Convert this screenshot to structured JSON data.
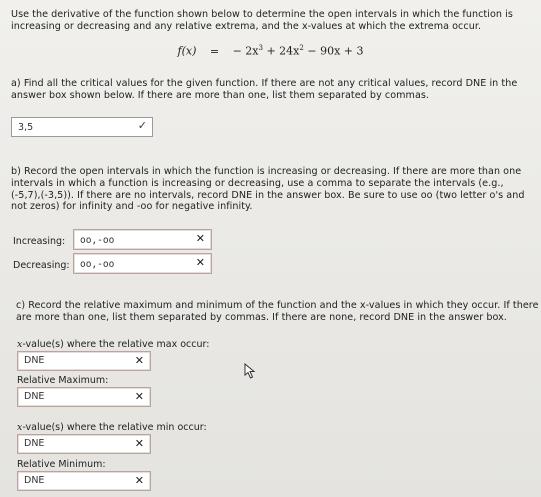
{
  "question": {
    "line1": "Use the derivative of the function shown below to determine the open intervals in which the function is",
    "line2": "increasing or decreasing and any relative extrema, and the x-values at which the extrema occur."
  },
  "equation": {
    "lhs": "f(x)",
    "eq": "=",
    "term1": "− 2x",
    "exp1": "3",
    "term2": " + 24x",
    "exp2": "2",
    "term3": " − 90x + 3"
  },
  "part_a": {
    "line1": "a) Find all the critical values for the given function. If there are not any critical values, record DNE in the",
    "line2": "answer box shown below. If there are more than one, list them separated by commas.",
    "answer": "3,5",
    "status": "correct"
  },
  "part_b": {
    "line1": "b) Record the open intervals in which the function is increasing or decreasing. If there are more than one",
    "line2": "intervals in which a function is increasing or decreasing, use a comma to separate the intervals (e.g.,",
    "line3": "(-5,7),(-3,5)). If there are no intervals, record DNE in the answer box. Be sure to use oo (two letter o's and",
    "line4": "not zeros) for infinity and -oo for negative infinity.",
    "increasing_label": "Increasing:",
    "increasing_value": "oo,-oo",
    "decreasing_label": "Decreasing:",
    "decreasing_value": "oo,-oo"
  },
  "part_c": {
    "line1": "c) Record the relative maximum and minimum of the function and the x-values in which they occur. If there",
    "line2": "are more than one, list them separated by commas. If there are none, record DNE in the answer box.",
    "max_x_label_var": "x",
    "max_x_label": "-value(s) where the relative max occur:",
    "max_x_value": "DNE",
    "rel_max_label": "Relative Maximum:",
    "rel_max_value": "DNE",
    "min_x_label_var": "x",
    "min_x_label": "-value(s) where the relative min occur:",
    "min_x_value": "DNE",
    "rel_min_label": "Relative Minimum:",
    "rel_min_value": "DNE"
  },
  "icons": {
    "check": "✓",
    "x": "✕"
  }
}
